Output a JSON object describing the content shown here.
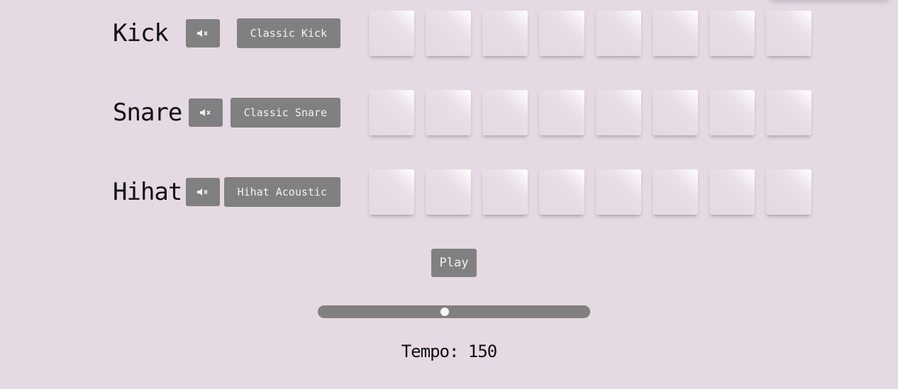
{
  "tracks": [
    {
      "name": "Kick",
      "sample_label": "Classic Kick",
      "steps": [
        false,
        false,
        false,
        false,
        false,
        false,
        false,
        false
      ]
    },
    {
      "name": "Snare",
      "sample_label": "Classic Snare",
      "steps": [
        false,
        false,
        false,
        false,
        false,
        false,
        false,
        false
      ]
    },
    {
      "name": "Hihat",
      "sample_label": "Hihat Acoustic",
      "steps": [
        false,
        false,
        false,
        false,
        false,
        false,
        false,
        false
      ]
    }
  ],
  "mute_icon": "speaker-muted-icon",
  "transport": {
    "play_label": "Play"
  },
  "tempo": {
    "label": "Tempo:",
    "value": 150,
    "slider_fraction": 0.465
  },
  "colors": {
    "background": "#e5d9e3",
    "button": "#808080",
    "button_text": "#f2f2f2"
  }
}
